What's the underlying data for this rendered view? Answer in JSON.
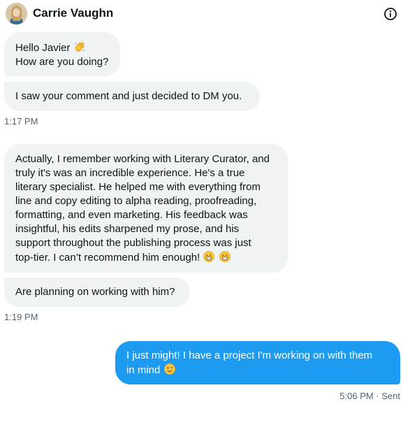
{
  "header": {
    "contact_name": "Carrie Vaughn",
    "avatar_icon": "profile-photo",
    "info_icon": "info-icon"
  },
  "messages": [
    {
      "direction": "incoming",
      "lines": [
        "Hello Javier",
        "How are you doing?"
      ],
      "emoji": [
        "waving-hand"
      ]
    },
    {
      "direction": "incoming",
      "lines": [
        "I saw your comment and just decided to DM you."
      ]
    },
    {
      "direction": "incoming",
      "lines": [
        "Actually, I remember working with Literary Curator, and",
        "truly it's was an incredible experience. He's a true",
        "literary specialist. He helped me with everything from",
        "line and copy editing to alpha reading, proofreading,",
        "formatting, and even marketing. His feedback was",
        "insightful, his edits sharpened my prose, and his",
        "support throughout the publishing process was just",
        "top-tier. I can’t recommend him enough!"
      ],
      "emoji": [
        "grinning-face",
        "grinning-face"
      ]
    },
    {
      "direction": "incoming",
      "lines": [
        "Are planning on working with him?"
      ]
    },
    {
      "direction": "outgoing",
      "lines": [
        "I just might! I have a project I'm working on with them",
        "in mind"
      ],
      "emoji": [
        "winking-face"
      ]
    }
  ],
  "timestamps": {
    "group1": "1:17 PM",
    "group2": "1:19 PM",
    "group3": "5:06 PM · Sent"
  },
  "colors": {
    "incoming_bubble": "#eff3f4",
    "outgoing_bubble": "#1d9bf0",
    "timestamp_text": "#536471"
  }
}
